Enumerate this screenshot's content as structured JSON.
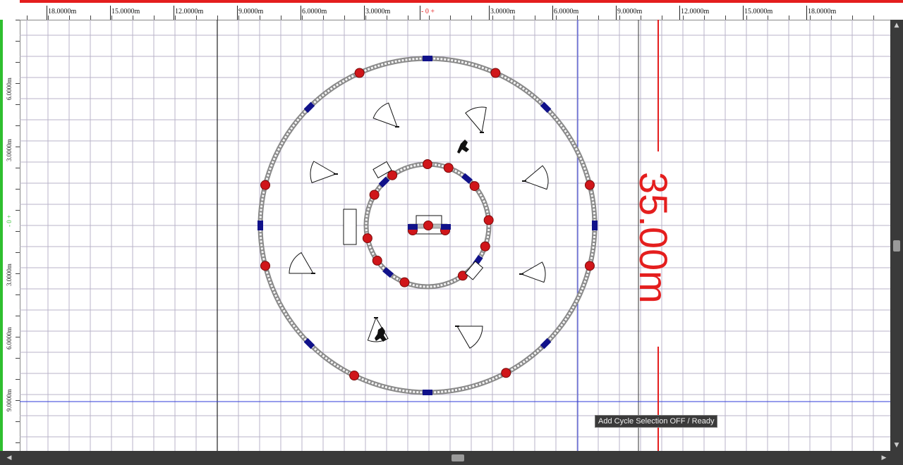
{
  "ruler_top": {
    "labels": [
      "18.0000m",
      "15.0000m",
      "12.0000m",
      "9.0000m",
      "6.0000m",
      "3.0000m",
      "- 0 +",
      "3.0000m",
      "6.0000m",
      "9.0000m",
      "12.0000m",
      "15.0000m",
      "18.0000m"
    ]
  },
  "ruler_left": {
    "labels": [
      "6.0000m",
      "3.0000m",
      "- 0 +",
      "3.0000m",
      "6.0000m",
      "9.0000m"
    ]
  },
  "dimension": {
    "text": "35.00m"
  },
  "status": {
    "text": "Add Cycle Selection OFF / Ready"
  },
  "colors": {
    "grid": "#b9b3c9",
    "truss": "#8a8a8a",
    "light_fixture": "#d0161a",
    "clamp": "#11128a",
    "guide_blue": "#2f3bd8",
    "dimension_red": "#e41e1e",
    "ruler_x_accent": "#e41e1e",
    "ruler_y_accent": "#2fbf2f"
  },
  "icons": {
    "corner": "origin-crosshair-icon",
    "scroll_up": "arrow-up-icon",
    "scroll_down": "arrow-down-icon",
    "scroll_left": "arrow-left-icon",
    "scroll_right": "arrow-right-icon"
  }
}
